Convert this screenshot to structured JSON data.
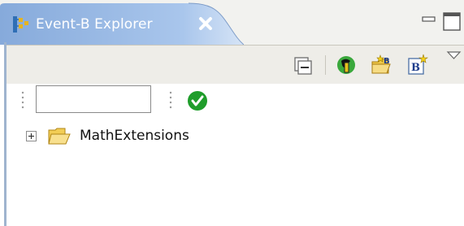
{
  "view": {
    "title": "Event-B Explorer",
    "icon": "event-b-explorer-icon",
    "close": "close-icon"
  },
  "window_controls": [
    "minimize-icon",
    "maximize-icon"
  ],
  "toolbar": {
    "buttons": [
      "collapse-all-icon",
      "new-project-icon",
      "new-component-icon",
      "new-event-b-icon",
      "view-menu-icon"
    ]
  },
  "filter": {
    "value": "",
    "placeholder": "",
    "apply_icon": "checkmark-icon"
  },
  "tree": {
    "items": [
      {
        "label": "MathExtensions",
        "icon": "open-folder-icon",
        "expander": "plus-icon"
      }
    ]
  },
  "colors": {
    "tab_gradient_start": "#8fb2e0",
    "tab_gradient_end": "#c7dcf4",
    "toolbar_bg": "#eeede8",
    "accent_green": "#1f9d2b"
  }
}
